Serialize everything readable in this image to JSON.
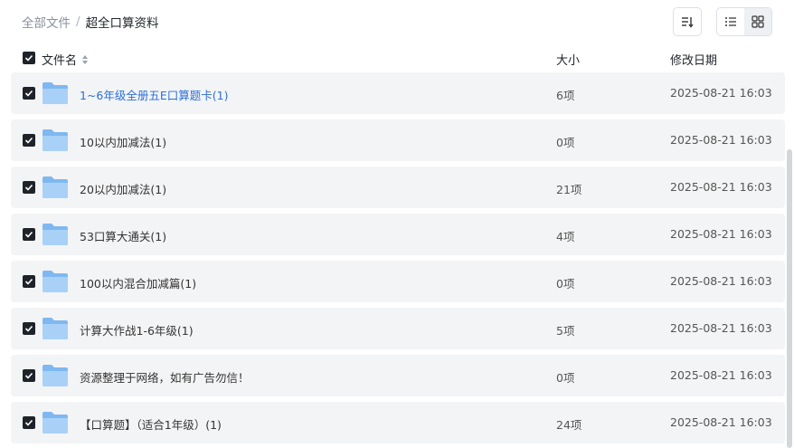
{
  "breadcrumb": {
    "root": "全部文件",
    "separator": "/",
    "current": "超全口算资料"
  },
  "toolbar": {
    "sort_icon": "sort-icon",
    "list_view_icon": "list-view-icon",
    "grid_view_icon": "grid-view-icon"
  },
  "table": {
    "columns": {
      "name": "文件名",
      "size": "大小",
      "date": "修改日期"
    },
    "rows": [
      {
        "name": "1~6年级全册五E口算题卡(1)",
        "size": "6项",
        "date": "2025-08-21 16:03"
      },
      {
        "name": "10以内加减法(1)",
        "size": "0项",
        "date": "2025-08-21 16:03"
      },
      {
        "name": "20以内加减法(1)",
        "size": "21项",
        "date": "2025-08-21 16:03"
      },
      {
        "name": "53口算大通关(1)",
        "size": "4项",
        "date": "2025-08-21 16:03"
      },
      {
        "name": "100以内混合加减篇(1)",
        "size": "0项",
        "date": "2025-08-21 16:03"
      },
      {
        "name": "计算大作战1-6年级(1)",
        "size": "5项",
        "date": "2025-08-21 16:03"
      },
      {
        "name": "资源整理于网络，如有广告勿信！",
        "size": "0项",
        "date": "2025-08-21 16:03"
      },
      {
        "name": "【口算题】（适合1年级）(1)",
        "size": "24项",
        "date": "2025-08-21 16:03"
      }
    ]
  },
  "colors": {
    "accent_link": "#2b6fd6",
    "row_background": "#f3f4f6",
    "checkbox": "#1f2329",
    "folder": "#7fb8f0"
  }
}
